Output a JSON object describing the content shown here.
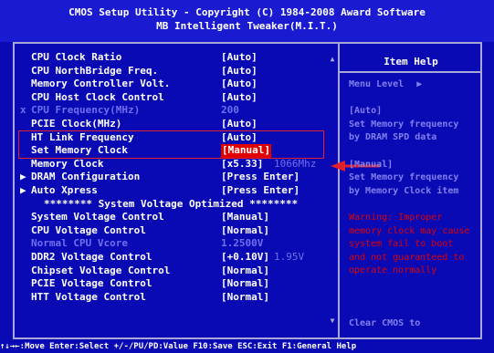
{
  "title": {
    "line1": "CMOS Setup Utility - Copyright (C) 1984-2008 Award Software",
    "line2": "MB Intelligent Tweaker(M.I.T.)"
  },
  "menu": [
    {
      "label": "CPU Clock Ratio",
      "value": "[Auto]"
    },
    {
      "label": "CPU NorthBridge Freq.",
      "value": "[Auto]"
    },
    {
      "label": "Memory Controller Volt.",
      "value": "[Auto]"
    },
    {
      "label": "CPU Host Clock Control",
      "value": "[Auto]"
    },
    {
      "label": "CPU Frequency(MHz)",
      "value": "200",
      "marker": "x"
    },
    {
      "label": "PCIE Clock(MHz)",
      "value": "[Auto]"
    },
    {
      "label": "HT Link Frequency",
      "value": "[Auto]"
    },
    {
      "label": "Set Memory Clock",
      "value": "[Manual]"
    },
    {
      "label": "Memory Clock",
      "value": "[x5.33]",
      "extra": "1066Mhz"
    },
    {
      "label": "DRAM Configuration",
      "value": "[Press Enter]",
      "marker": "▶"
    },
    {
      "label": "Auto Xpress",
      "value": "[Press Enter]",
      "marker": "▶"
    },
    {
      "label": "******** System Voltage Optimized ********"
    },
    {
      "label": "System Voltage Control",
      "value": "[Manual]"
    },
    {
      "label": "CPU Voltage Control",
      "value": "[Normal]"
    },
    {
      "label": "Normal CPU Vcore",
      "value": "1.2500V"
    },
    {
      "label": "DDR2 Voltage Control",
      "value": "[+0.10V]",
      "extra": "1.95V"
    },
    {
      "label": "Chipset Voltage Control",
      "value": "[Normal]"
    },
    {
      "label": "PCIE Voltage Control",
      "value": "[Normal]"
    },
    {
      "label": "HTT Voltage Control",
      "value": "[Normal]"
    }
  ],
  "help": {
    "title": "Item Help",
    "menu_level": "Menu Level",
    "menu_level_arrow": "▶",
    "auto_title": "[Auto]",
    "auto_line1": "Set Memory frequency",
    "auto_line2": "by DRAM SPD data",
    "manual_title": "[Manual]",
    "manual_line1": "Set Memory frequency",
    "manual_line2": "by Memory Clock item",
    "warning_lines": [
      "Warning: Improper",
      "memory clock may cause",
      "system fail to boot",
      "and not guaranteed to",
      "operate normally"
    ],
    "clear_cmos": "Clear CMOS to"
  },
  "status_bar": "↑↓→←:Move  Enter:Select  +/-/PU/PD:Value  F10:Save  ESC:Exit  F1:General Help",
  "colors": {
    "background": "#0a0ab4",
    "disabled_text": "#6f6fef",
    "selection": "#e00000",
    "annotation": "#e0202a"
  }
}
